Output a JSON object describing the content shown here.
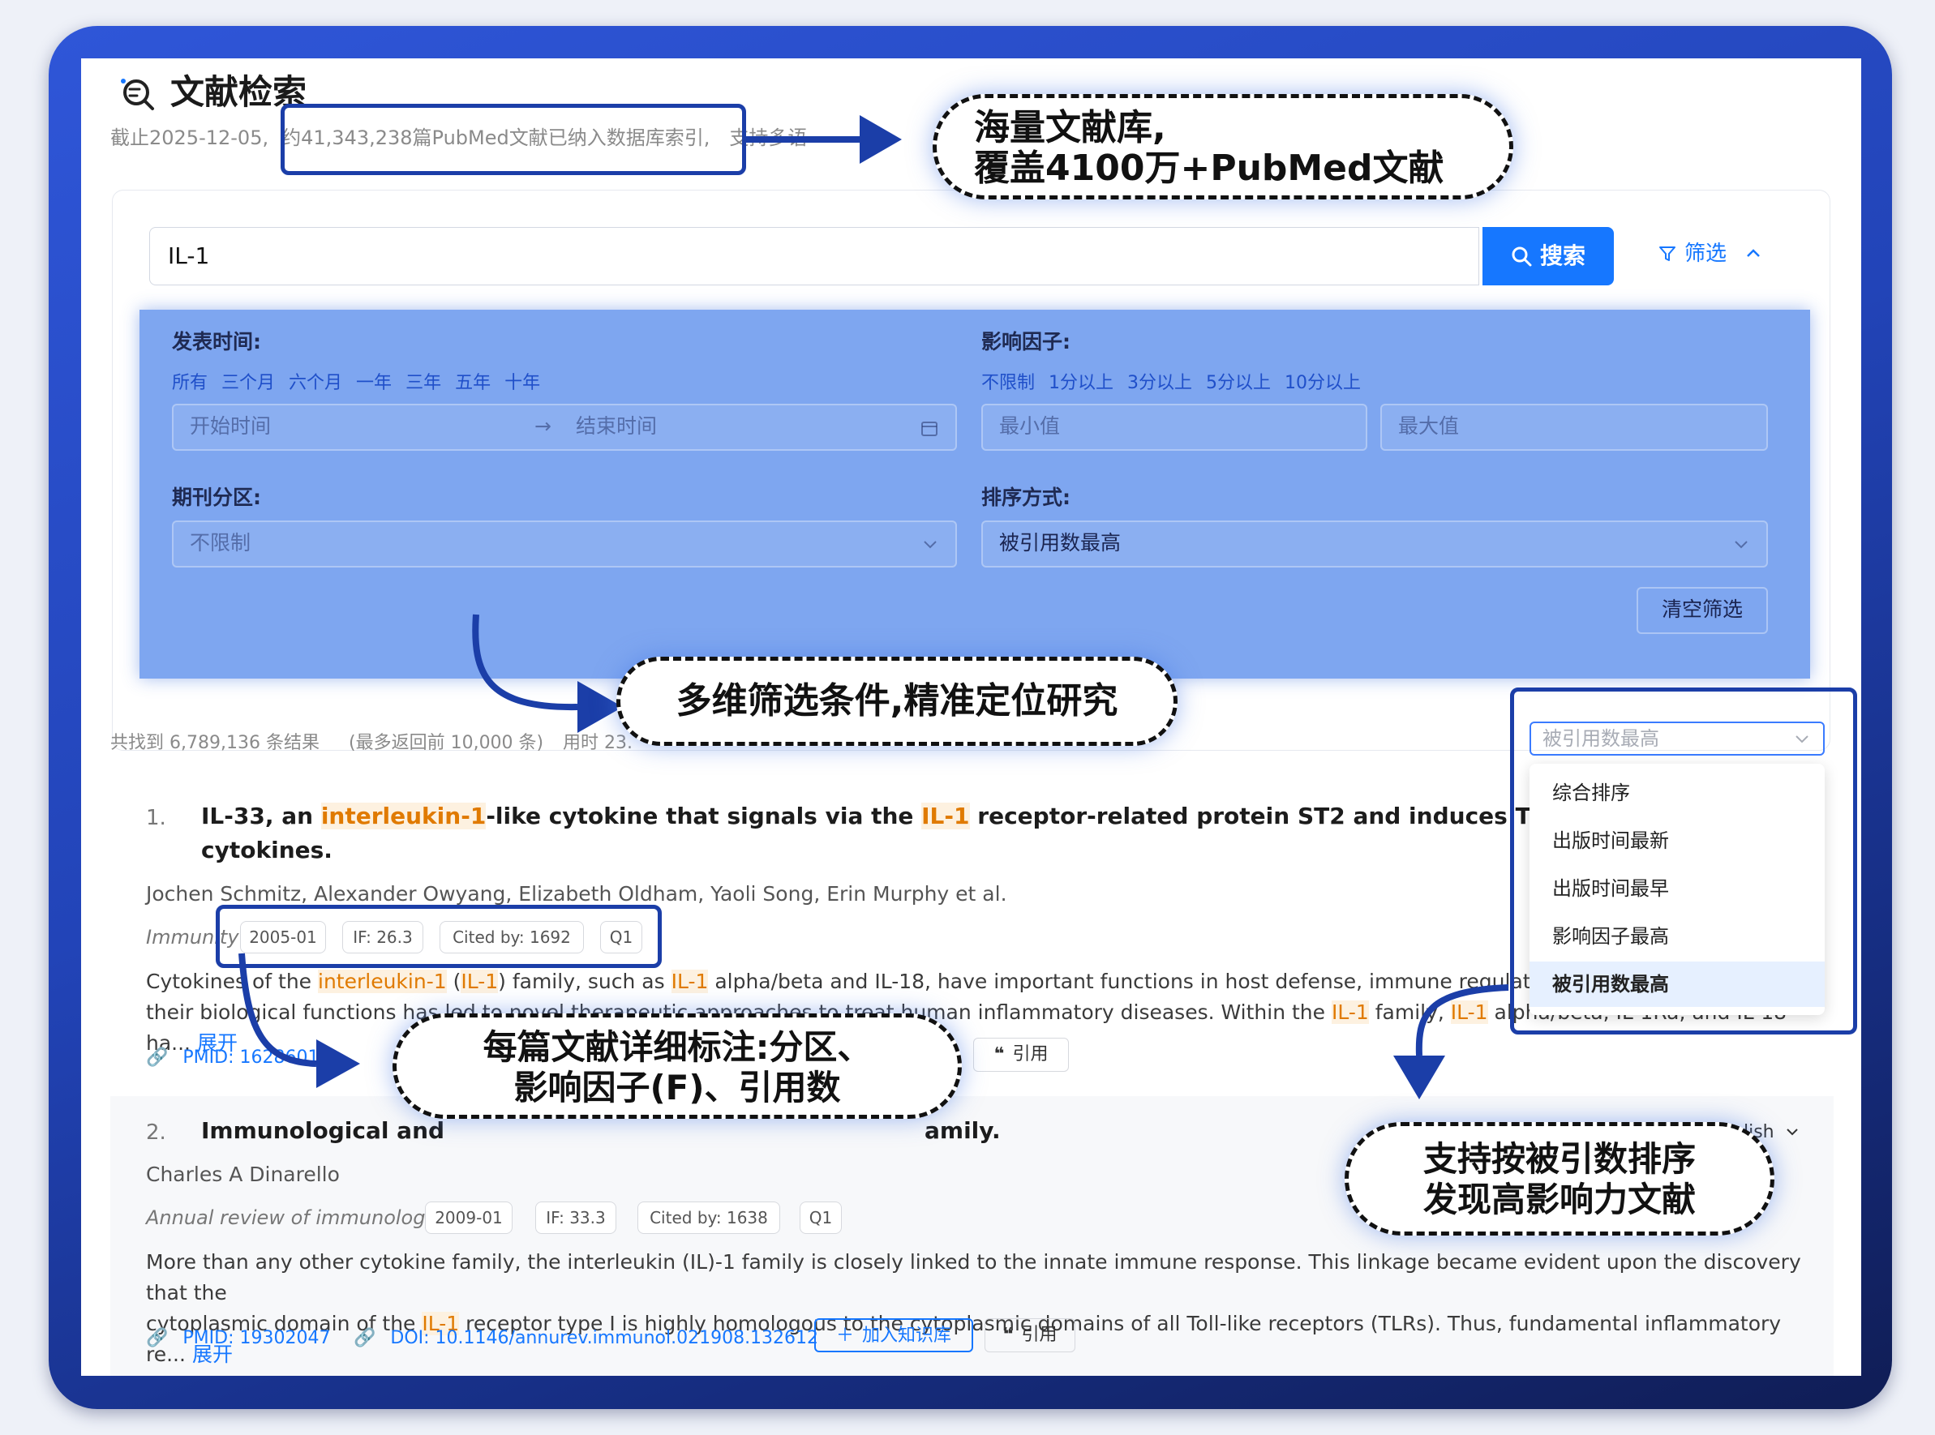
{
  "header": {
    "title": "文献检索",
    "subtitle_prefix": "截止2025-12-05,",
    "subtitle_highlight": "约41,343,238篇PubMed文献已纳入数据库索引,",
    "subtitle_suffix": "支持多语"
  },
  "search": {
    "query": "IL-1",
    "button_label": "搜索",
    "filter_label": "筛选"
  },
  "filters": {
    "date_label": "发表时间:",
    "date_options": [
      "所有",
      "三个月",
      "六个月",
      "一年",
      "三年",
      "五年",
      "十年"
    ],
    "date_start_placeholder": "开始时间",
    "date_end_placeholder": "结束时间",
    "if_label": "影响因子:",
    "if_options": [
      "不限制",
      "1分以上",
      "3分以上",
      "5分以上",
      "10分以上"
    ],
    "if_min_placeholder": "最小值",
    "if_max_placeholder": "最大值",
    "zone_label": "期刊分区:",
    "zone_value": "不限制",
    "sort_label": "排序方式:",
    "sort_value": "被引用数最高",
    "clear_label": "清空筛选"
  },
  "results_meta": {
    "count_text": "共找到 6,789,136 条结果",
    "limit_text": "(最多返回前 10,000 条)",
    "time_text": "用时 23."
  },
  "sort_dropdown": {
    "selected": "被引用数最高",
    "options": [
      "综合排序",
      "出版时间最新",
      "出版时间最早",
      "影响因子最高",
      "被引用数最高"
    ]
  },
  "results": [
    {
      "num": "1.",
      "title_parts": [
        "IL-33, an ",
        "interleukin-1",
        "-like cytokine that signals via the ",
        "IL-1",
        " receptor-related protein ST2 and induces T helper type 2-",
        "cytokines."
      ],
      "authors": "Jochen Schmitz, Alexander Owyang, Elizabeth Oldham, Yaoli Song, Erin Murphy et al.",
      "journal": "Immunity",
      "date": "2005-01",
      "if": "IF: 26.3",
      "cited": "Cited by: 1692",
      "zone": "Q1",
      "abstract_parts": [
        "Cytokines of the ",
        "interleukin-1",
        " (",
        "IL-1",
        ") family, such as ",
        "IL-1",
        " alpha/beta and IL-18, have important functions in host defense, immune regulation, an",
        "their biological functions has led to novel therapeutic approaches to treat human inflammatory diseases. Within the ",
        "IL-1",
        " family, ",
        "IL-1",
        " alpha/beta, IL-1Ra, and IL-18 ha...",
        "展开"
      ],
      "pmid": "PMID: 16286016",
      "cite_label": "引用"
    },
    {
      "num": "2.",
      "title_start": "Immunological and",
      "title_end": "amily.",
      "authors": "Charles A Dinarello",
      "journal": "Annual review of immunology",
      "date": "2009-01",
      "if": "IF: 33.3",
      "cited": "Cited by: 1638",
      "zone": "Q1",
      "abstract_line1": "More than any other cytokine family, the interleukin (IL)-1 family is closely linked to the innate immune response. This linkage became evident upon the discovery that the",
      "abstract_line2_parts": [
        "cytoplasmic domain of the ",
        "IL-1",
        " receptor type I is highly homologous to the cytoplasmic domains of all Toll-like receptors (TLRs). Thus, fundamental inflammatory re...",
        "展开"
      ],
      "pmid": "PMID: 19302047",
      "doi": "DOI: 10.1146/annurev.immunol.021908.132612",
      "add_label": "加入知识库",
      "cite_label": "引用",
      "publish_label": "lish"
    }
  ],
  "annotations": {
    "a1_line1": "海量文献库,",
    "a1_line2": "覆盖4100万+PubMed文献",
    "a2": "多维筛选条件,精准定位研究",
    "a3_line1": "每篇文献详细标注:分区、",
    "a3_line2": "影响因子(F)、引用数",
    "a4_line1": "支持按被引数排序",
    "a4_line2": "发现高影响力文献"
  },
  "colors": {
    "primary": "#1677ff",
    "highlight": "#e07a00",
    "frame": "#2244b8",
    "annotation_border": "#1b3ea8"
  }
}
